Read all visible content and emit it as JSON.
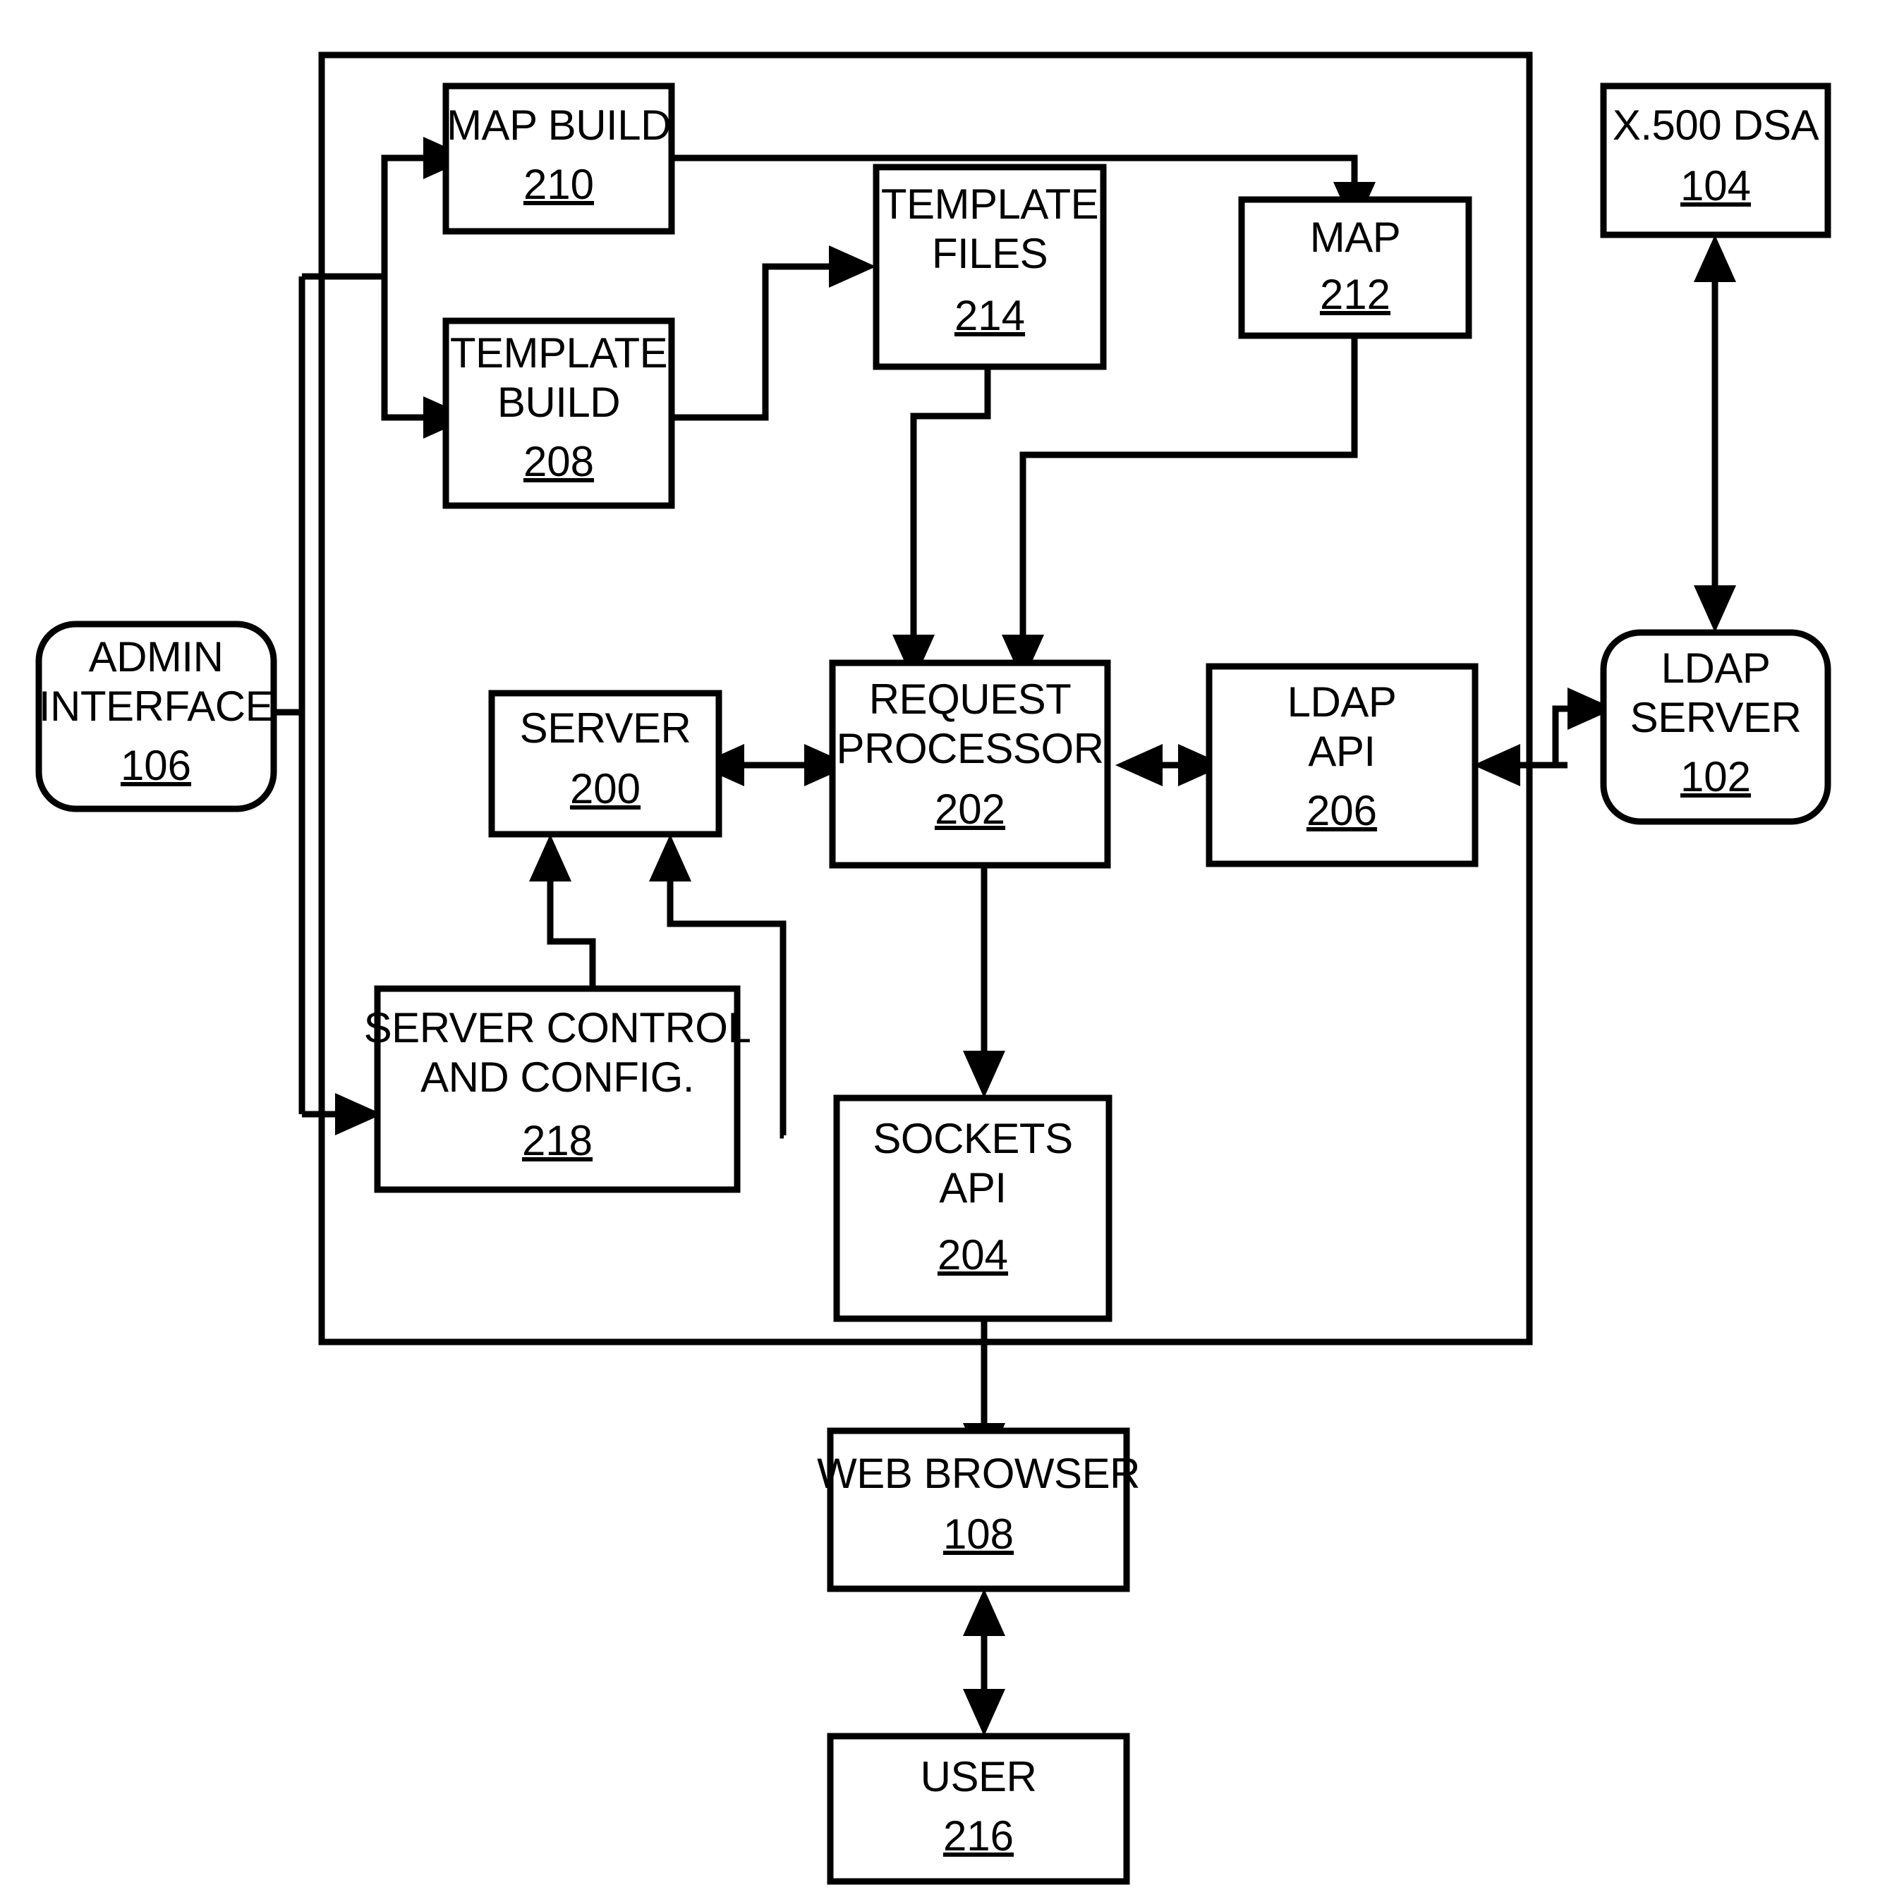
{
  "figure": {
    "type": "patent-block-diagram",
    "background_color": "#ffffff",
    "line_color": "#000000",
    "system_boundary_label": ""
  },
  "nodes": {
    "map_build": {
      "line1": "MAP BUILD",
      "line2": "",
      "ref": "210",
      "shape": "rect"
    },
    "template_build": {
      "line1": "TEMPLATE",
      "line2": "BUILD",
      "ref": "208",
      "shape": "rect"
    },
    "template_files": {
      "line1": "TEMPLATE",
      "line2": "FILES",
      "ref": "214",
      "shape": "rect"
    },
    "map": {
      "line1": "MAP",
      "line2": "",
      "ref": "212",
      "shape": "rect"
    },
    "x500_dsa": {
      "line1": "X.500 DSA",
      "line2": "",
      "ref": "104",
      "shape": "rect"
    },
    "ldap_server": {
      "line1": "LDAP",
      "line2": "SERVER",
      "ref": "102",
      "shape": "rounded"
    },
    "admin_interface": {
      "line1": "ADMIN",
      "line2": "INTERFACE",
      "ref": "106",
      "shape": "rounded"
    },
    "server": {
      "line1": "SERVER",
      "line2": "",
      "ref": "200",
      "shape": "rect"
    },
    "request_processor": {
      "line1": "REQUEST",
      "line2": "PROCESSOR",
      "ref": "202",
      "shape": "rect"
    },
    "ldap_api": {
      "line1": "LDAP",
      "line2": "API",
      "ref": "206",
      "shape": "rect"
    },
    "server_control": {
      "line1": "SERVER CONTROL",
      "line2": "AND CONFIG.",
      "ref": "218",
      "shape": "rect"
    },
    "sockets_api": {
      "line1": "SOCKETS",
      "line2": "API",
      "ref": "204",
      "shape": "rect"
    },
    "web_browser": {
      "line1": "WEB BROWSER",
      "line2": "",
      "ref": "108",
      "shape": "rect"
    },
    "user": {
      "line1": "USER",
      "line2": "",
      "ref": "216",
      "shape": "rect"
    }
  },
  "connections": [
    {
      "name": "admin-to-map-build",
      "from": "admin_interface",
      "to": "map_build",
      "arrows": "one-way"
    },
    {
      "name": "admin-to-template-build",
      "from": "admin_interface",
      "to": "template_build",
      "arrows": "one-way"
    },
    {
      "name": "admin-to-server-control",
      "from": "admin_interface",
      "to": "server_control",
      "arrows": "one-way"
    },
    {
      "name": "map-build-to-map",
      "from": "map_build",
      "to": "map",
      "arrows": "one-way"
    },
    {
      "name": "template-build-to-template-files",
      "from": "template_build",
      "to": "template_files",
      "arrows": "one-way"
    },
    {
      "name": "template-files-to-request-processor",
      "from": "template_files",
      "to": "request_processor",
      "arrows": "one-way"
    },
    {
      "name": "map-to-request-processor",
      "from": "map",
      "to": "request_processor",
      "arrows": "one-way"
    },
    {
      "name": "server-request-processor",
      "from": "server",
      "to": "request_processor",
      "arrows": "two-way"
    },
    {
      "name": "request-processor-ldap-api",
      "from": "request_processor",
      "to": "ldap_api",
      "arrows": "two-way"
    },
    {
      "name": "ldap-api-ldap-server",
      "from": "ldap_api",
      "to": "ldap_server",
      "arrows": "two-way"
    },
    {
      "name": "ldap-server-x500-dsa",
      "from": "ldap_server",
      "to": "x500_dsa",
      "arrows": "two-way"
    },
    {
      "name": "request-processor-to-sockets",
      "from": "request_processor",
      "to": "sockets_api",
      "arrows": "one-way"
    },
    {
      "name": "server-control-to-server",
      "from": "server_control",
      "to": "server",
      "arrows": "one-way"
    },
    {
      "name": "sockets-to-server",
      "from": "sockets_api",
      "to": "server",
      "arrows": "one-way"
    },
    {
      "name": "sockets-web-browser",
      "from": "sockets_api",
      "to": "web_browser",
      "arrows": "two-way"
    },
    {
      "name": "web-browser-user",
      "from": "web_browser",
      "to": "user",
      "arrows": "two-way"
    }
  ]
}
